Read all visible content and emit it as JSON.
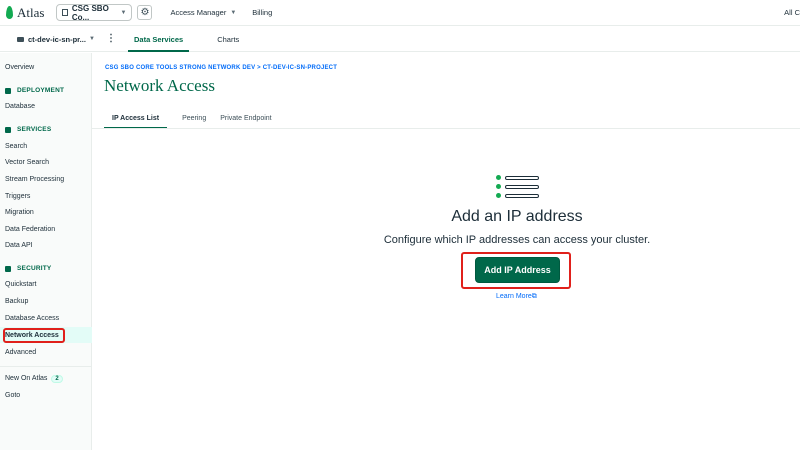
{
  "topbar": {
    "logo_text": "Atlas",
    "org_name": "CSG SBO Co...",
    "access_manager": "Access Manager",
    "billing": "Billing",
    "right_text": "All C"
  },
  "projbar": {
    "project_name": "ct-dev-ic-sn-pr...",
    "tabs": [
      {
        "label": "Data Services"
      },
      {
        "label": "Charts"
      }
    ]
  },
  "sidebar": {
    "overview": "Overview",
    "deployment": {
      "title": "DEPLOYMENT",
      "items": [
        "Database"
      ]
    },
    "services": {
      "title": "SERVICES",
      "items": [
        "Search",
        "Vector Search",
        "Stream Processing",
        "Triggers",
        "Migration",
        "Data Federation",
        "Data API"
      ]
    },
    "security": {
      "title": "SECURITY",
      "items": [
        "Quickstart",
        "Backup",
        "Database Access",
        "Network Access",
        "Advanced"
      ]
    },
    "new_on_atlas": "New On Atlas",
    "new_on_atlas_count": "2",
    "goto": "Goto"
  },
  "main": {
    "breadcrumb": "CSG SBO CORE TOOLS STRONG NETWORK DEV > CT-DEV-IC-SN-PROJECT",
    "title": "Network Access",
    "tabs": [
      {
        "label": "IP Access List"
      },
      {
        "label": "Peering"
      },
      {
        "label": "Private Endpoint"
      }
    ],
    "empty_state": {
      "title": "Add an IP address",
      "subtitle": "Configure which IP addresses can access your cluster.",
      "button": "Add IP Address",
      "link": "Learn More"
    }
  },
  "colors": {
    "brand_green": "#00684a",
    "leaf_green": "#13aa52",
    "link_blue": "#016bf8",
    "annotation_red": "#e0201b"
  }
}
